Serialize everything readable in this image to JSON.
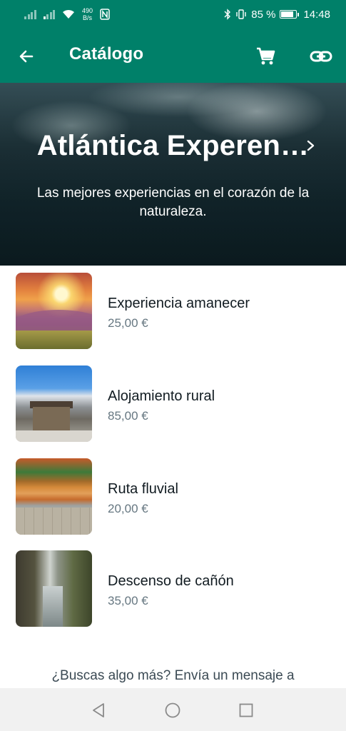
{
  "status_bar": {
    "network_speed_value": "490",
    "network_speed_unit": "B/s",
    "battery": "85 %",
    "battery_level": 0.85,
    "time": "14:48",
    "icons": [
      "signal-icon",
      "signal-icon",
      "wifi-icon",
      "nfc-icon",
      "bluetooth-icon",
      "vibrate-icon",
      "battery-icon"
    ]
  },
  "app_bar": {
    "title": "Catálogo",
    "icons": [
      "back-arrow-icon",
      "cart-icon",
      "link-icon"
    ],
    "background_color": "#008069"
  },
  "hero": {
    "title": "Atlántica Experen…",
    "subtitle": "Las mejores experiencias en el corazón de la naturaleza."
  },
  "products": [
    {
      "name": "Experiencia amanecer",
      "price": "25,00 €"
    },
    {
      "name": "Alojamiento rural",
      "price": "85,00 €"
    },
    {
      "name": "Ruta fluvial",
      "price": "20,00 €"
    },
    {
      "name": "Descenso de cañón",
      "price": "35,00 €"
    }
  ],
  "footer": {
    "more_text": "¿Buscas algo más? Envía un mensaje a"
  },
  "nav_bar": {
    "icons": [
      "nav-back-icon",
      "nav-home-icon",
      "nav-recent-icon"
    ]
  }
}
